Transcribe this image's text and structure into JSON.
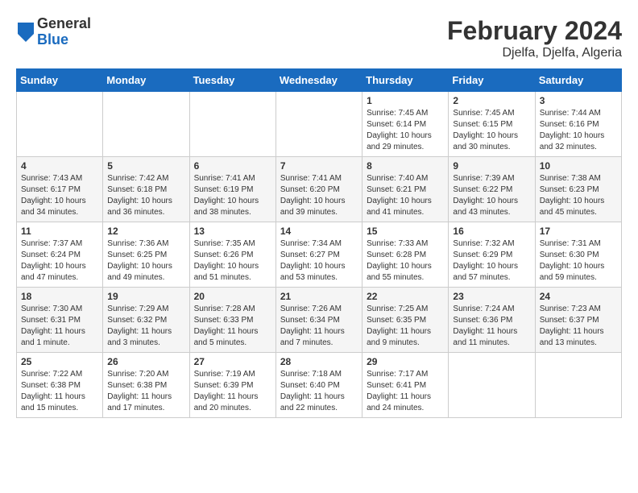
{
  "header": {
    "logo_general": "General",
    "logo_blue": "Blue",
    "title": "February 2024",
    "subtitle": "Djelfa, Djelfa, Algeria"
  },
  "days_of_week": [
    "Sunday",
    "Monday",
    "Tuesday",
    "Wednesday",
    "Thursday",
    "Friday",
    "Saturday"
  ],
  "weeks": [
    [
      {
        "day": "",
        "info": ""
      },
      {
        "day": "",
        "info": ""
      },
      {
        "day": "",
        "info": ""
      },
      {
        "day": "",
        "info": ""
      },
      {
        "day": "1",
        "info": "Sunrise: 7:45 AM\nSunset: 6:14 PM\nDaylight: 10 hours\nand 29 minutes."
      },
      {
        "day": "2",
        "info": "Sunrise: 7:45 AM\nSunset: 6:15 PM\nDaylight: 10 hours\nand 30 minutes."
      },
      {
        "day": "3",
        "info": "Sunrise: 7:44 AM\nSunset: 6:16 PM\nDaylight: 10 hours\nand 32 minutes."
      }
    ],
    [
      {
        "day": "4",
        "info": "Sunrise: 7:43 AM\nSunset: 6:17 PM\nDaylight: 10 hours\nand 34 minutes."
      },
      {
        "day": "5",
        "info": "Sunrise: 7:42 AM\nSunset: 6:18 PM\nDaylight: 10 hours\nand 36 minutes."
      },
      {
        "day": "6",
        "info": "Sunrise: 7:41 AM\nSunset: 6:19 PM\nDaylight: 10 hours\nand 38 minutes."
      },
      {
        "day": "7",
        "info": "Sunrise: 7:41 AM\nSunset: 6:20 PM\nDaylight: 10 hours\nand 39 minutes."
      },
      {
        "day": "8",
        "info": "Sunrise: 7:40 AM\nSunset: 6:21 PM\nDaylight: 10 hours\nand 41 minutes."
      },
      {
        "day": "9",
        "info": "Sunrise: 7:39 AM\nSunset: 6:22 PM\nDaylight: 10 hours\nand 43 minutes."
      },
      {
        "day": "10",
        "info": "Sunrise: 7:38 AM\nSunset: 6:23 PM\nDaylight: 10 hours\nand 45 minutes."
      }
    ],
    [
      {
        "day": "11",
        "info": "Sunrise: 7:37 AM\nSunset: 6:24 PM\nDaylight: 10 hours\nand 47 minutes."
      },
      {
        "day": "12",
        "info": "Sunrise: 7:36 AM\nSunset: 6:25 PM\nDaylight: 10 hours\nand 49 minutes."
      },
      {
        "day": "13",
        "info": "Sunrise: 7:35 AM\nSunset: 6:26 PM\nDaylight: 10 hours\nand 51 minutes."
      },
      {
        "day": "14",
        "info": "Sunrise: 7:34 AM\nSunset: 6:27 PM\nDaylight: 10 hours\nand 53 minutes."
      },
      {
        "day": "15",
        "info": "Sunrise: 7:33 AM\nSunset: 6:28 PM\nDaylight: 10 hours\nand 55 minutes."
      },
      {
        "day": "16",
        "info": "Sunrise: 7:32 AM\nSunset: 6:29 PM\nDaylight: 10 hours\nand 57 minutes."
      },
      {
        "day": "17",
        "info": "Sunrise: 7:31 AM\nSunset: 6:30 PM\nDaylight: 10 hours\nand 59 minutes."
      }
    ],
    [
      {
        "day": "18",
        "info": "Sunrise: 7:30 AM\nSunset: 6:31 PM\nDaylight: 11 hours\nand 1 minute."
      },
      {
        "day": "19",
        "info": "Sunrise: 7:29 AM\nSunset: 6:32 PM\nDaylight: 11 hours\nand 3 minutes."
      },
      {
        "day": "20",
        "info": "Sunrise: 7:28 AM\nSunset: 6:33 PM\nDaylight: 11 hours\nand 5 minutes."
      },
      {
        "day": "21",
        "info": "Sunrise: 7:26 AM\nSunset: 6:34 PM\nDaylight: 11 hours\nand 7 minutes."
      },
      {
        "day": "22",
        "info": "Sunrise: 7:25 AM\nSunset: 6:35 PM\nDaylight: 11 hours\nand 9 minutes."
      },
      {
        "day": "23",
        "info": "Sunrise: 7:24 AM\nSunset: 6:36 PM\nDaylight: 11 hours\nand 11 minutes."
      },
      {
        "day": "24",
        "info": "Sunrise: 7:23 AM\nSunset: 6:37 PM\nDaylight: 11 hours\nand 13 minutes."
      }
    ],
    [
      {
        "day": "25",
        "info": "Sunrise: 7:22 AM\nSunset: 6:38 PM\nDaylight: 11 hours\nand 15 minutes."
      },
      {
        "day": "26",
        "info": "Sunrise: 7:20 AM\nSunset: 6:38 PM\nDaylight: 11 hours\nand 17 minutes."
      },
      {
        "day": "27",
        "info": "Sunrise: 7:19 AM\nSunset: 6:39 PM\nDaylight: 11 hours\nand 20 minutes."
      },
      {
        "day": "28",
        "info": "Sunrise: 7:18 AM\nSunset: 6:40 PM\nDaylight: 11 hours\nand 22 minutes."
      },
      {
        "day": "29",
        "info": "Sunrise: 7:17 AM\nSunset: 6:41 PM\nDaylight: 11 hours\nand 24 minutes."
      },
      {
        "day": "",
        "info": ""
      },
      {
        "day": "",
        "info": ""
      }
    ]
  ]
}
